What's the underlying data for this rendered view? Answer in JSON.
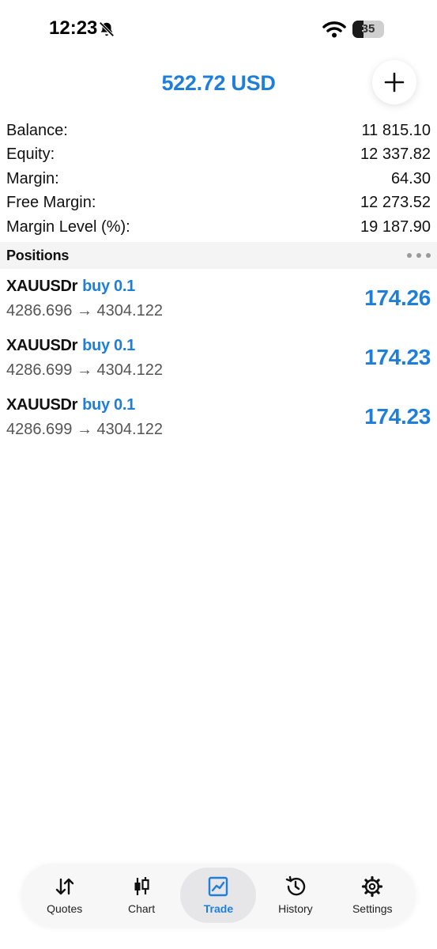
{
  "status_bar": {
    "time": "12:23",
    "battery": "35"
  },
  "header": {
    "title": "522.72 USD"
  },
  "summary": [
    {
      "label": "Balance:",
      "value": "11 815.10"
    },
    {
      "label": "Equity:",
      "value": "12 337.82"
    },
    {
      "label": "Margin:",
      "value": "64.30"
    },
    {
      "label": "Free Margin:",
      "value": "12 273.52"
    },
    {
      "label": "Margin Level (%):",
      "value": "19 187.90"
    }
  ],
  "positions": {
    "title": "Positions",
    "items": [
      {
        "symbol": "XAUUSDr",
        "side": "buy 0.1",
        "prices": "4286.696 → 4304.122",
        "profit": "174.26"
      },
      {
        "symbol": "XAUUSDr",
        "side": "buy 0.1",
        "prices": "4286.699 → 4304.122",
        "profit": "174.23"
      },
      {
        "symbol": "XAUUSDr",
        "side": "buy 0.1",
        "prices": "4286.699 → 4304.122",
        "profit": "174.23"
      }
    ]
  },
  "nav": [
    {
      "label": "Quotes",
      "icon": "quotes-arrows-icon",
      "active": false
    },
    {
      "label": "Chart",
      "icon": "candlestick-icon",
      "active": false
    },
    {
      "label": "Trade",
      "icon": "trade-chart-icon",
      "active": true
    },
    {
      "label": "History",
      "icon": "history-clock-icon",
      "active": false
    },
    {
      "label": "Settings",
      "icon": "gear-icon",
      "active": false
    }
  ],
  "colors": {
    "accent": "#1f7fd8",
    "text": "#111111",
    "secondary_text": "#555555",
    "section_bg": "#f4f4f5"
  }
}
